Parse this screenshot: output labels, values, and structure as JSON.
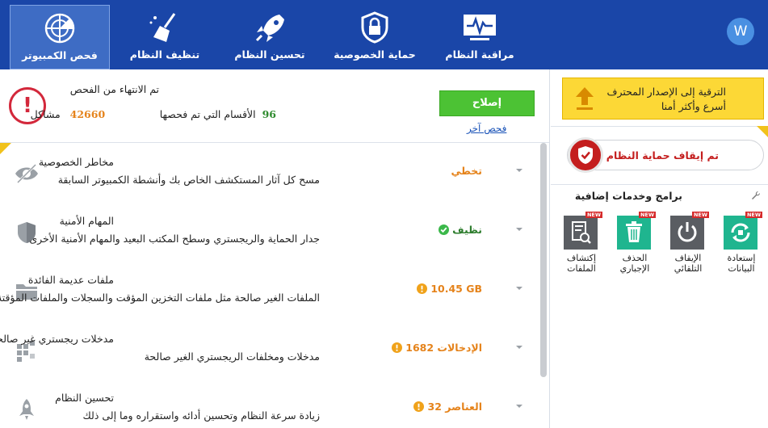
{
  "topbar": {
    "tabs": [
      {
        "label": "فحص الكمبيوتر",
        "icon": "radar-scan-icon"
      },
      {
        "label": "تنظيف النظام",
        "icon": "broom-icon"
      },
      {
        "label": "تحسين النظام",
        "icon": "rocket-icon"
      },
      {
        "label": "حماية الخصوصية",
        "icon": "shield-lock-icon"
      },
      {
        "label": "مراقبة النظام",
        "icon": "monitor-pulse-icon"
      }
    ],
    "logo_letter": "W"
  },
  "scan": {
    "title": "تم الانتهاء من الفحص",
    "problems_value": "42660",
    "problems_label": "مشاكل",
    "sections_value": "96",
    "sections_label": "الأقسام التي تم فحصها",
    "fix_label": "إصلاح",
    "rescan_label": "فحص آخر"
  },
  "rows": [
    {
      "title": "مخاطر الخصوصية",
      "desc": "مسح كل آثار المستكشف الخاص بك وأنشطة الكمبيوتر السابقة",
      "status": "تخطي",
      "icon": "eye-hidden-icon"
    },
    {
      "title": "المهام الأمنية",
      "desc": "جدار الحماية والريجستري وسطح المكتب البعيد والمهام الأمنية الأخرى",
      "status": "نظيف",
      "icon": "shield-icon"
    },
    {
      "title": "ملفات عديمة الفائدة",
      "desc": "الملفات الغير صالحة مثل ملفات التخزين المؤقت والسجلات والملفات المؤقتة...",
      "status": "10.45 GB",
      "icon": "folder-icon"
    },
    {
      "title": "مدخلات ريجستري غير صالحة",
      "desc": "مدخلات ومخلفات الريجستري الغير صالحة",
      "status": "الإدخالات 1682",
      "icon": "registry-blocks-icon"
    },
    {
      "title": "تحسين النظام",
      "desc": "زيادة سرعة النظام وتحسين أدائه واستقراره وما إلى ذلك",
      "status": "العناصر 32",
      "icon": "rocket-icon"
    }
  ],
  "side": {
    "upgrade_line1": "الترقية إلى الإصدار المحترف",
    "upgrade_line2": "أسرع وأكثر أمنا",
    "protect_label": "تم إيقاف حماية النظام",
    "addons_title": "برامج وخدمات إضافية",
    "new_badge": "NEW",
    "tools": [
      {
        "line1": "إكتشاف",
        "line2": "الملفات",
        "color": "#5a5d62",
        "icon": "file-search-icon"
      },
      {
        "line1": "الحذف",
        "line2": "الإجباري",
        "color": "#1fb58f",
        "icon": "trash-icon"
      },
      {
        "line1": "الإيقاف",
        "line2": "التلقائي",
        "color": "#5a5d62",
        "icon": "power-icon"
      },
      {
        "line1": "إستعادة",
        "line2": "البيانات",
        "color": "#1fb58f",
        "icon": "data-recovery-icon"
      }
    ]
  },
  "colors": {
    "topbar": "#1a46a8",
    "fix_button": "#4cc234",
    "alert": "#d3283b",
    "warning_orange": "#e5831b",
    "upgrade_yellow": "#fcd836"
  }
}
